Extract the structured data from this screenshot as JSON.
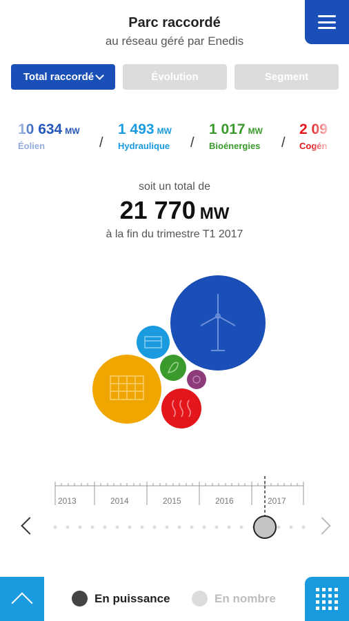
{
  "header": {
    "title": "Parc raccordé",
    "subtitle": "au réseau géré par Enedis"
  },
  "tabs": [
    {
      "label": "Total raccordé",
      "active": true
    },
    {
      "label": "Évolution",
      "active": false
    },
    {
      "label": "Segment",
      "active": false
    }
  ],
  "stats": [
    {
      "value": "10 634",
      "unit": "MW",
      "label": "Éolien",
      "color": "#1a4fb8"
    },
    {
      "value": "1 493",
      "unit": "MW",
      "label": "Hydraulique",
      "color": "#1a9be0"
    },
    {
      "value": "1 017",
      "unit": "MW",
      "label": "Bioénergies",
      "color": "#3a9a2c"
    },
    {
      "value": "2 09",
      "unit": "",
      "label": "Cogén",
      "color": "#e3161c"
    }
  ],
  "separator": "/",
  "total": {
    "prefix": "soit un total de",
    "value": "21 770",
    "unit": "MW",
    "suffix": "à la fin du trimestre T1 2017"
  },
  "bubbles": [
    {
      "name": "eolien",
      "icon": "wind-turbine-icon",
      "color": "#1a4fb8"
    },
    {
      "name": "solaire",
      "icon": "solar-panel-icon",
      "color": "#efa600"
    },
    {
      "name": "hydraulique",
      "icon": "water-icon",
      "color": "#1a9be0"
    },
    {
      "name": "bioenergies",
      "icon": "leaf-icon",
      "color": "#3a9a2c"
    },
    {
      "name": "autres",
      "icon": "other-icon",
      "color": "#8e3b7c"
    },
    {
      "name": "cogeneration",
      "icon": "heat-icon",
      "color": "#e3161c"
    }
  ],
  "timeline": {
    "years": [
      "2013",
      "2014",
      "2015",
      "2016",
      "2017"
    ],
    "selected": "T1 2017"
  },
  "footer": {
    "toggle_power": "En puissance",
    "toggle_count": "En nombre"
  }
}
